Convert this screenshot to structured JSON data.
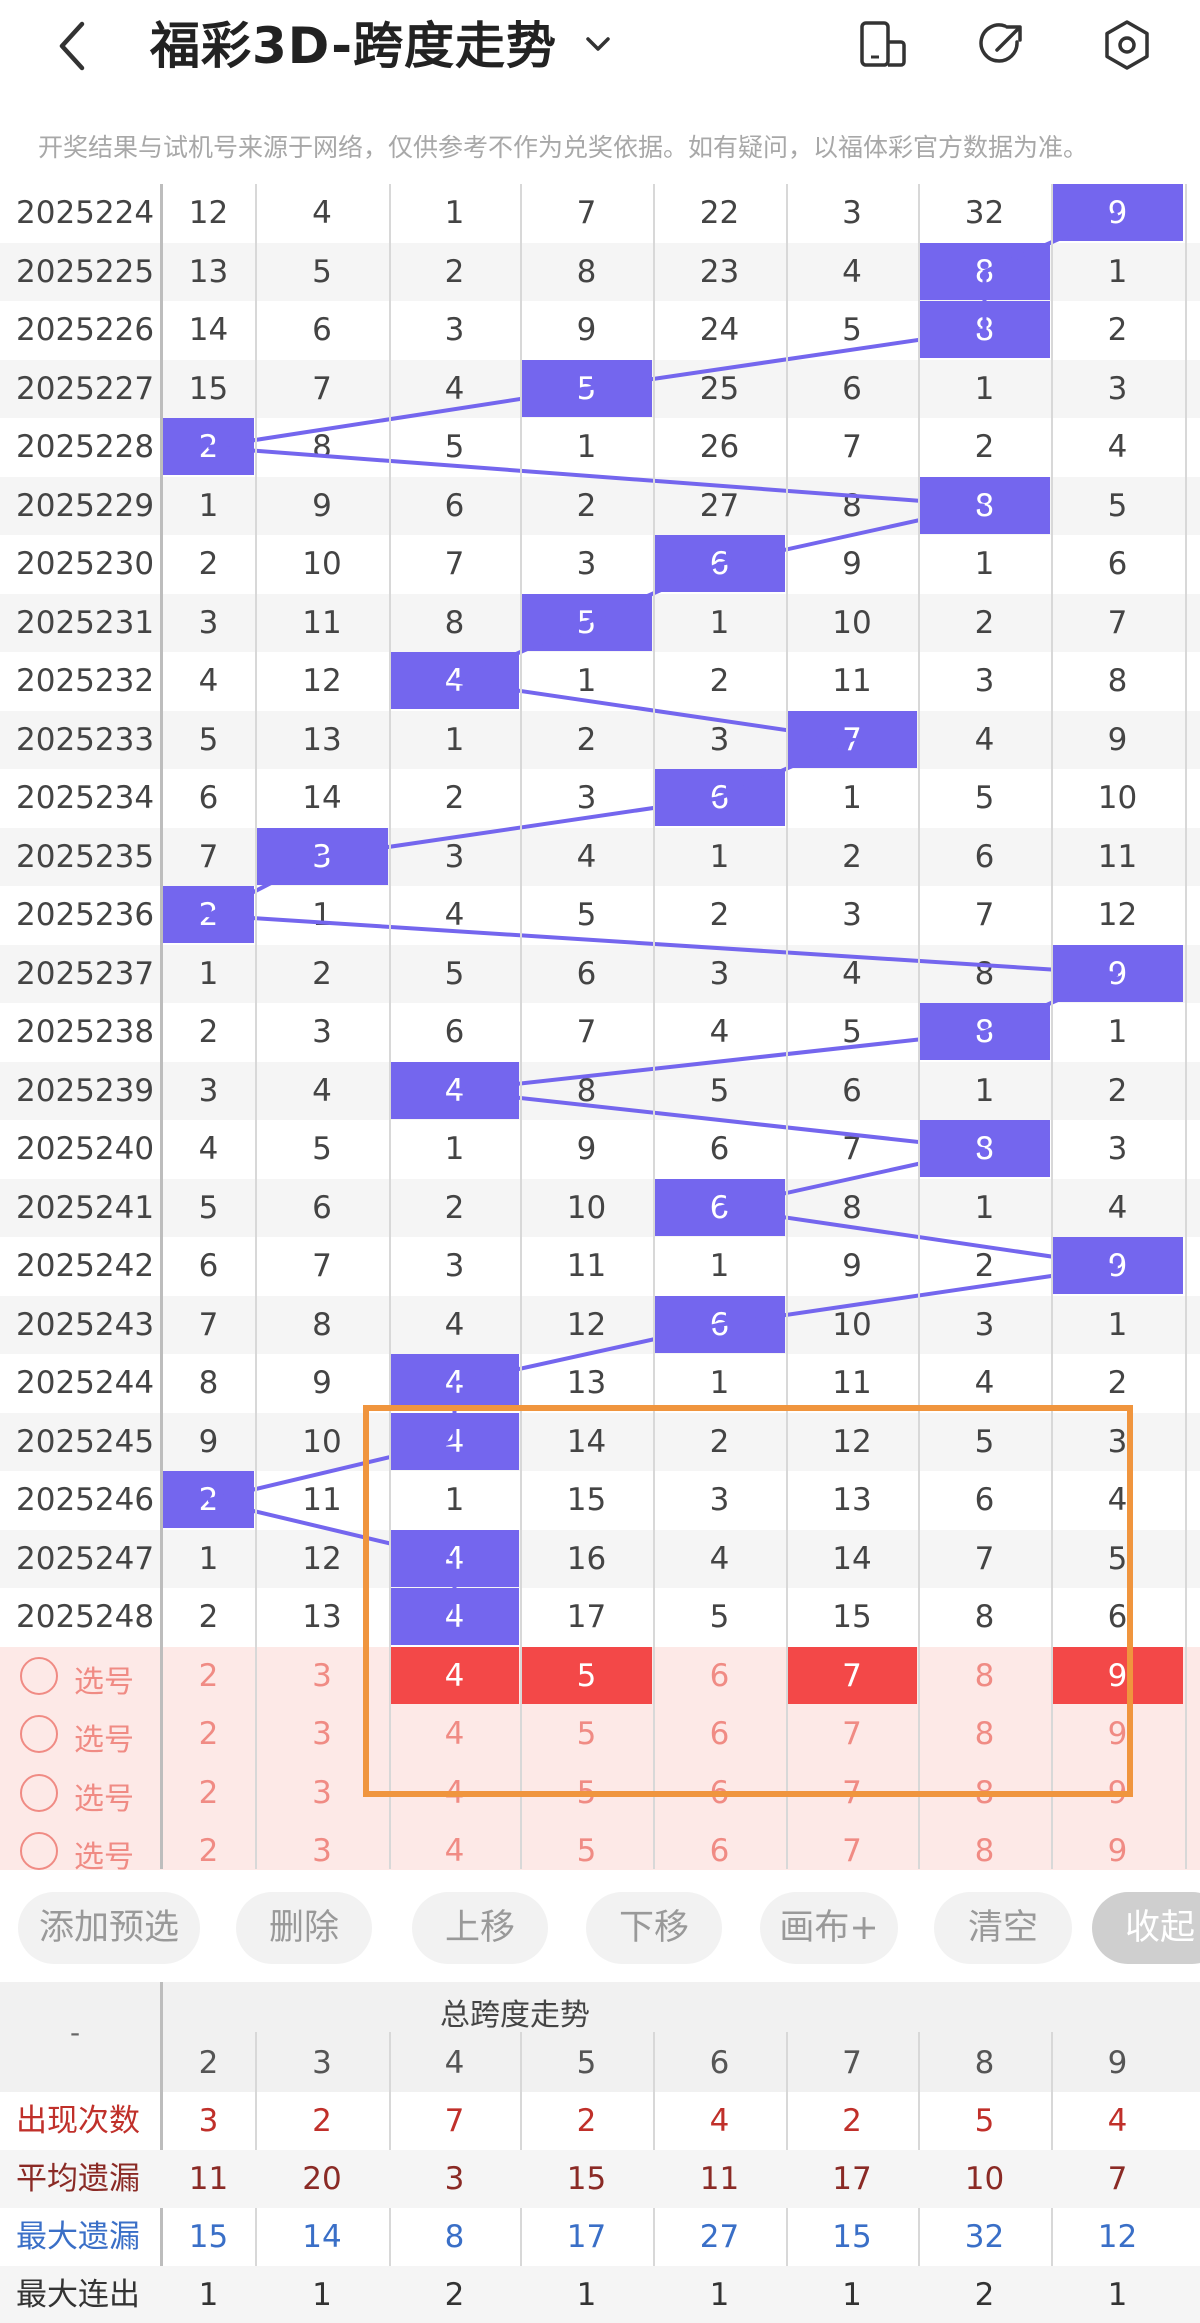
{
  "header": {
    "title": "福彩3D-跨度走势",
    "notice": "开奖结果与试机号来源于网络，仅供参考不作为兑奖依据。如有疑问，以福体彩官方数据为准。"
  },
  "table": {
    "rows": [
      {
        "issue": "2025224",
        "v": [
          12,
          4,
          1,
          7,
          22,
          3,
          32,
          9
        ],
        "hit": 7
      },
      {
        "issue": "2025225",
        "v": [
          13,
          5,
          2,
          8,
          23,
          4,
          8,
          1
        ],
        "hit": 6
      },
      {
        "issue": "2025226",
        "v": [
          14,
          6,
          3,
          9,
          24,
          5,
          8,
          2
        ],
        "hit": 6
      },
      {
        "issue": "2025227",
        "v": [
          15,
          7,
          4,
          5,
          25,
          6,
          1,
          3
        ],
        "hit": 3
      },
      {
        "issue": "2025228",
        "v": [
          2,
          8,
          5,
          1,
          26,
          7,
          2,
          4
        ],
        "hit": 0
      },
      {
        "issue": "2025229",
        "v": [
          1,
          9,
          6,
          2,
          27,
          8,
          8,
          5
        ],
        "hit": 6
      },
      {
        "issue": "2025230",
        "v": [
          2,
          10,
          7,
          3,
          6,
          9,
          1,
          6
        ],
        "hit": 4
      },
      {
        "issue": "2025231",
        "v": [
          3,
          11,
          8,
          5,
          1,
          10,
          2,
          7
        ],
        "hit": 3
      },
      {
        "issue": "2025232",
        "v": [
          4,
          12,
          4,
          1,
          2,
          11,
          3,
          8
        ],
        "hit": 2
      },
      {
        "issue": "2025233",
        "v": [
          5,
          13,
          1,
          2,
          3,
          7,
          4,
          9
        ],
        "hit": 5
      },
      {
        "issue": "2025234",
        "v": [
          6,
          14,
          2,
          3,
          6,
          1,
          5,
          10
        ],
        "hit": 4
      },
      {
        "issue": "2025235",
        "v": [
          7,
          3,
          3,
          4,
          1,
          2,
          6,
          11
        ],
        "hit": 1
      },
      {
        "issue": "2025236",
        "v": [
          2,
          1,
          4,
          5,
          2,
          3,
          7,
          12
        ],
        "hit": 0
      },
      {
        "issue": "2025237",
        "v": [
          1,
          2,
          5,
          6,
          3,
          4,
          8,
          9
        ],
        "hit": 7
      },
      {
        "issue": "2025238",
        "v": [
          2,
          3,
          6,
          7,
          4,
          5,
          8,
          1
        ],
        "hit": 6
      },
      {
        "issue": "2025239",
        "v": [
          3,
          4,
          4,
          8,
          5,
          6,
          1,
          2
        ],
        "hit": 2
      },
      {
        "issue": "2025240",
        "v": [
          4,
          5,
          1,
          9,
          6,
          7,
          8,
          3
        ],
        "hit": 6
      },
      {
        "issue": "2025241",
        "v": [
          5,
          6,
          2,
          10,
          6,
          8,
          1,
          4
        ],
        "hit": 4
      },
      {
        "issue": "2025242",
        "v": [
          6,
          7,
          3,
          11,
          1,
          9,
          2,
          9
        ],
        "hit": 7
      },
      {
        "issue": "2025243",
        "v": [
          7,
          8,
          4,
          12,
          6,
          10,
          3,
          1
        ],
        "hit": 4
      },
      {
        "issue": "2025244",
        "v": [
          8,
          9,
          4,
          13,
          1,
          11,
          4,
          2
        ],
        "hit": 2
      },
      {
        "issue": "2025245",
        "v": [
          9,
          10,
          4,
          14,
          2,
          12,
          5,
          3
        ],
        "hit": 2
      },
      {
        "issue": "2025246",
        "v": [
          2,
          11,
          1,
          15,
          3,
          13,
          6,
          4
        ],
        "hit": 0
      },
      {
        "issue": "2025247",
        "v": [
          1,
          12,
          4,
          16,
          4,
          14,
          7,
          5
        ],
        "hit": 2
      },
      {
        "issue": "2025248",
        "v": [
          2,
          13,
          4,
          17,
          5,
          15,
          8,
          6
        ],
        "hit": 2
      }
    ],
    "select_rows": [
      {
        "label": "选号",
        "v": [
          "2",
          "3",
          "4",
          "5",
          "6",
          "7",
          "8",
          "9"
        ],
        "red": [
          2,
          3,
          5,
          7
        ]
      },
      {
        "label": "选号",
        "v": [
          "2",
          "3",
          "4",
          "5",
          "6",
          "7",
          "8",
          "9"
        ],
        "red": []
      },
      {
        "label": "选号",
        "v": [
          "2",
          "3",
          "4",
          "5",
          "6",
          "7",
          "8",
          "9"
        ],
        "red": []
      },
      {
        "label": "选号",
        "v": [
          "2",
          "3",
          "4",
          "5",
          "6",
          "7",
          "8",
          "9"
        ],
        "red": []
      }
    ]
  },
  "buttons": {
    "add": "添加预选",
    "delete": "删除",
    "up": "上移",
    "down": "下移",
    "canvas": "画布+",
    "clear": "清空",
    "collapse": "收起"
  },
  "stats": {
    "corner": "-",
    "title": "总跨度走势",
    "columns": [
      "2",
      "3",
      "4",
      "5",
      "6",
      "7",
      "8",
      "9"
    ],
    "rows": [
      {
        "label": "出现次数",
        "values": [
          "3",
          "2",
          "7",
          "2",
          "4",
          "2",
          "5",
          "4"
        ],
        "color": "#c0302a"
      },
      {
        "label": "平均遗漏",
        "values": [
          "11",
          "20",
          "3",
          "15",
          "11",
          "17",
          "10",
          "7"
        ],
        "color": "#8a2a25"
      },
      {
        "label": "最大遗漏",
        "values": [
          "15",
          "14",
          "8",
          "17",
          "27",
          "15",
          "32",
          "12"
        ],
        "color": "#3a6fc7"
      },
      {
        "label": "最大连出",
        "values": [
          "1",
          "1",
          "2",
          "1",
          "1",
          "1",
          "2",
          "1"
        ],
        "color": "#333333"
      }
    ]
  },
  "colors": {
    "hit": "#7466ee",
    "selected": "#f34848",
    "line": "#7466ee",
    "frame": "#f0953e"
  }
}
